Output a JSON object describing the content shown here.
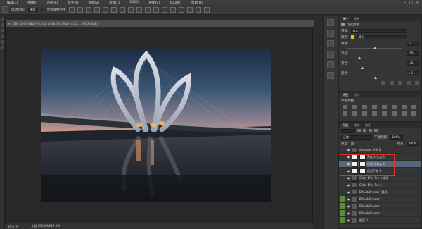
{
  "menubar": {
    "items": [
      "编辑(E)",
      "图像(I)",
      "图层(L)",
      "文字(Y)",
      "选择(S)",
      "滤镜(T)",
      "3D(D)",
      "视图(V)",
      "窗口(W)",
      "帮助(H)"
    ]
  },
  "optbar": {
    "auto_select_label": "自动选择:",
    "layer_label": "图层",
    "show_transform_label": "显示变换控件"
  },
  "document": {
    "tab_title": "DSC_2003-1826-9 (2).tif @ 16.7% (亮度/对比度 1, 图层蒙版/8) *",
    "zoom": "16.67%",
    "doc_size": "文档:100.6M/917.0M"
  },
  "properties": {
    "tabs": [
      "属性",
      "调整"
    ],
    "title": "可选颜色",
    "preset_label": "预设:",
    "preset_value": "自定",
    "colors_label": "颜色:",
    "colors_value": "黄色",
    "sliders": [
      {
        "label": "青色:",
        "value": "0",
        "level": 0.5
      },
      {
        "label": "洋红:",
        "value": "-56",
        "level": 0.22
      },
      {
        "label": "黄色:",
        "value": "-46",
        "level": 0.27
      },
      {
        "label": "黑色:",
        "value": "+2",
        "level": 0.51
      }
    ]
  },
  "adjustments": {
    "tabs": [
      "调整",
      "样式"
    ],
    "add_label": "添加调整"
  },
  "layers": {
    "tabs": [
      "图层",
      "通道",
      "路径"
    ],
    "blend_mode": "正常",
    "opacity_label": "不透明度:",
    "opacity_value": "100%",
    "lock_label": "锁定:",
    "fill_label": "填充:",
    "fill_value": "100%",
    "rows": [
      {
        "name": "dinglong 拷贝 2",
        "selected": false,
        "thumb": "dark",
        "green": false
      },
      {
        "name": "亮度/对比度 1",
        "selected": false,
        "thumb": "white",
        "green": false
      },
      {
        "name": "色相/饱和度 1",
        "selected": true,
        "thumb": "white",
        "green": false
      },
      {
        "name": "色彩平衡 1",
        "selected": false,
        "thumb": "white",
        "green": false
      },
      {
        "name": "Color Efex Pro 4 滤镜",
        "selected": false,
        "thumb": "dark",
        "green": false
      },
      {
        "name": "Color Efex Pro 4",
        "selected": false,
        "thumb": "dark",
        "green": false
      },
      {
        "name": "DXLabOnestar (最新)",
        "selected": false,
        "thumb": "dark",
        "green": false
      },
      {
        "name": "DXLabOnestar",
        "selected": false,
        "thumb": "dark",
        "green": true
      },
      {
        "name": "DXLabOnestar",
        "selected": false,
        "thumb": "dark",
        "green": true
      },
      {
        "name": "DXLabOnestar",
        "selected": false,
        "thumb": "dark",
        "green": true
      },
      {
        "name": "图层 0",
        "selected": false,
        "thumb": "dark",
        "green": true
      }
    ]
  },
  "colors": {
    "selection_outline": "#e0352b",
    "selected_row": "#55687c"
  }
}
